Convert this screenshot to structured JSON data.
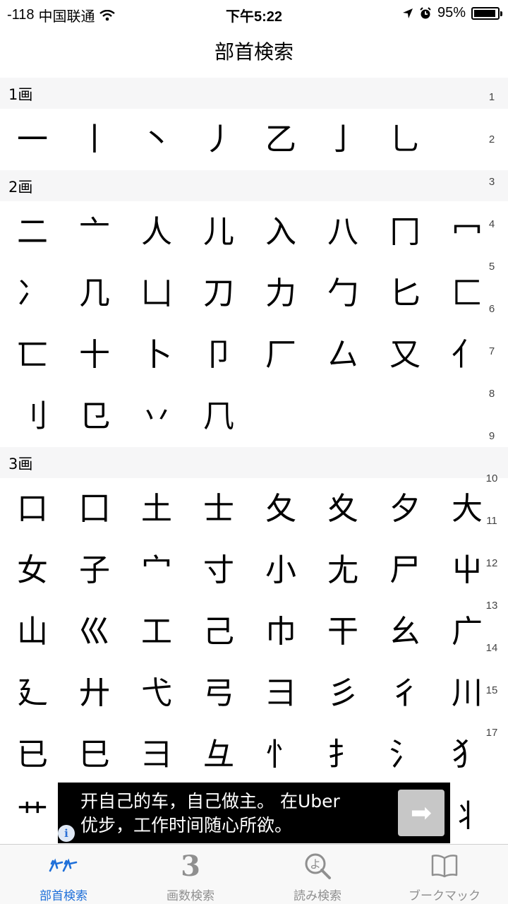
{
  "status_bar": {
    "signal": "-118",
    "carrier": "中国联通",
    "time": "下午5:22",
    "battery_percent": "95%",
    "battery_level": 0.95
  },
  "nav": {
    "title": "部首検索"
  },
  "sections": [
    {
      "header": "1画",
      "radicals": [
        "一",
        "丨",
        "丶",
        "丿",
        "乙",
        "亅",
        "乚"
      ]
    },
    {
      "header": "2画",
      "radicals": [
        "二",
        "亠",
        "人",
        "儿",
        "入",
        "八",
        "冂",
        "冖",
        "冫",
        "几",
        "凵",
        "刀",
        "力",
        "勹",
        "匕",
        "匚",
        "匸",
        "十",
        "卜",
        "卩",
        "厂",
        "厶",
        "又",
        "亻",
        "刂",
        "㔾",
        "丷",
        "𠘨"
      ]
    },
    {
      "header": "3画",
      "radicals": [
        "口",
        "囗",
        "土",
        "士",
        "夂",
        "夊",
        "夕",
        "大",
        "女",
        "子",
        "宀",
        "寸",
        "小",
        "尢",
        "尸",
        "屮",
        "山",
        "巛",
        "工",
        "己",
        "巾",
        "干",
        "幺",
        "广",
        "廴",
        "廾",
        "弋",
        "弓",
        "彐",
        "彡",
        "彳",
        "川",
        "已",
        "巳",
        "彐",
        "彑",
        "忄",
        "扌",
        "氵",
        "犭",
        "艹",
        "",
        "",
        "",
        "",
        "",
        "",
        "丬"
      ]
    }
  ],
  "index_bar": [
    "1",
    "2",
    "3",
    "4",
    "5",
    "6",
    "7",
    "8",
    "9",
    "10",
    "11",
    "12",
    "13",
    "14",
    "15",
    "17"
  ],
  "ad": {
    "line1": "开自己的车，自己做主。 在Uber",
    "line2": "优步，工作时间随心所欲。",
    "arrow": "➡",
    "info": "i"
  },
  "tabs": [
    {
      "label": "部首検索",
      "icon": "radical-search-icon",
      "active": true
    },
    {
      "label": "画数検索",
      "icon_text": "3",
      "icon": "stroke-count-icon",
      "active": false
    },
    {
      "label": "読み検索",
      "icon": "reading-search-icon",
      "active": false
    },
    {
      "label": "ブークマック",
      "icon": "bookmark-book-icon",
      "active": false
    }
  ],
  "colors": {
    "accent": "#1e6fd9",
    "inactive": "#8f8f8f",
    "section_bg": "#f6f6f7",
    "ad_bg": "#000000"
  }
}
